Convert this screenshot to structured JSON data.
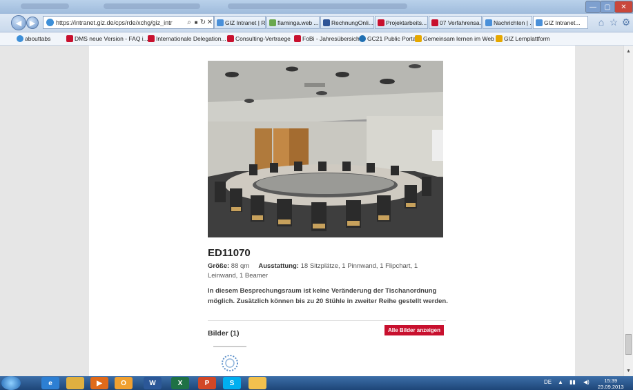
{
  "browser": {
    "window_title": "GIZ Intranet",
    "window_controls": [
      "—",
      "▢",
      "✕"
    ],
    "back_icon": "back-arrow-icon",
    "forward_icon": "forward-arrow-icon",
    "address": {
      "url": "https://intranet.giz.de/cps/rde/xchg/giz_intr",
      "search_glyph": "⌕",
      "lock_glyph": "🔒",
      "refresh_glyph": "↻",
      "stop_glyph": "✕"
    },
    "tabs": [
      {
        "label": "GIZ Intranet | R...",
        "color": "#4a90d9"
      },
      {
        "label": "flaminga.web ...",
        "color": "#6aa84f"
      },
      {
        "label": "RechnungOnli...",
        "color": "#2f5597"
      },
      {
        "label": "Projektarbeits...",
        "color": "#c8102e"
      },
      {
        "label": "07 Verfahrensa...",
        "color": "#c8102e"
      },
      {
        "label": "Nachrichten | ...",
        "color": "#4a90d9"
      },
      {
        "label": "GIZ Intranet...",
        "color": "#4a90d9",
        "active": true
      }
    ],
    "toolbar_icons": [
      "home-icon",
      "star-icon",
      "gear-icon"
    ],
    "favorites": [
      {
        "label": "abouttabs",
        "color": "#3d8fd8"
      },
      {
        "label": "DMS neue Version - FAQ i...",
        "color": "#c8102e"
      },
      {
        "label": "Internationale Delegation...",
        "color": "#c8102e"
      },
      {
        "label": "Consulting-Vertraege",
        "color": "#c8102e"
      },
      {
        "label": "FoBi - Jahresübersicht",
        "color": "#c8102e"
      },
      {
        "label": "GC21 Public Portal",
        "color": "#1f6fb2"
      },
      {
        "label": "Gemeinsam lernen im Web",
        "color": "#e6a800"
      },
      {
        "label": "GIZ Lernplattform",
        "color": "#e6a800"
      }
    ]
  },
  "room": {
    "id": "ED11070",
    "size_label": "Größe:",
    "size_value": "88 qm",
    "equipment_label": "Ausstattung:",
    "equipment_value": "18 Sitzplätze, 1 Pinnwand, 1 Flipchart, 1 Leinwand, 1 Beamer",
    "description": "In diesem Besprechungsraum ist keine Veränderung der Tischanordnung möglich. Zusätzlich können bis zu 20 Stühle in zweiter Reihe gestellt werden.",
    "images_heading": "Bilder (1)",
    "show_all_button": "Alle Bilder anzeigen"
  },
  "taskbar": {
    "apps": [
      {
        "name": "ie-icon",
        "label": "e",
        "color": "#2d7fd3"
      },
      {
        "name": "explorer-icon",
        "label": "",
        "color": "#e0b040"
      },
      {
        "name": "media-icon",
        "label": "▶",
        "color": "#e06a1a"
      },
      {
        "name": "outlook-icon",
        "label": "O",
        "color": "#f0a030"
      },
      {
        "name": "word-icon",
        "label": "W",
        "color": "#2b5797"
      },
      {
        "name": "excel-icon",
        "label": "X",
        "color": "#1e7145"
      },
      {
        "name": "powerpoint-icon",
        "label": "P",
        "color": "#d24726"
      },
      {
        "name": "skype-icon",
        "label": "S",
        "color": "#00aff0"
      },
      {
        "name": "folder-icon",
        "label": "",
        "color": "#f2c14e"
      }
    ],
    "language": "DE",
    "time": "15:39",
    "date": "23.09.2013"
  },
  "colors": {
    "accent_red": "#c8102e"
  }
}
